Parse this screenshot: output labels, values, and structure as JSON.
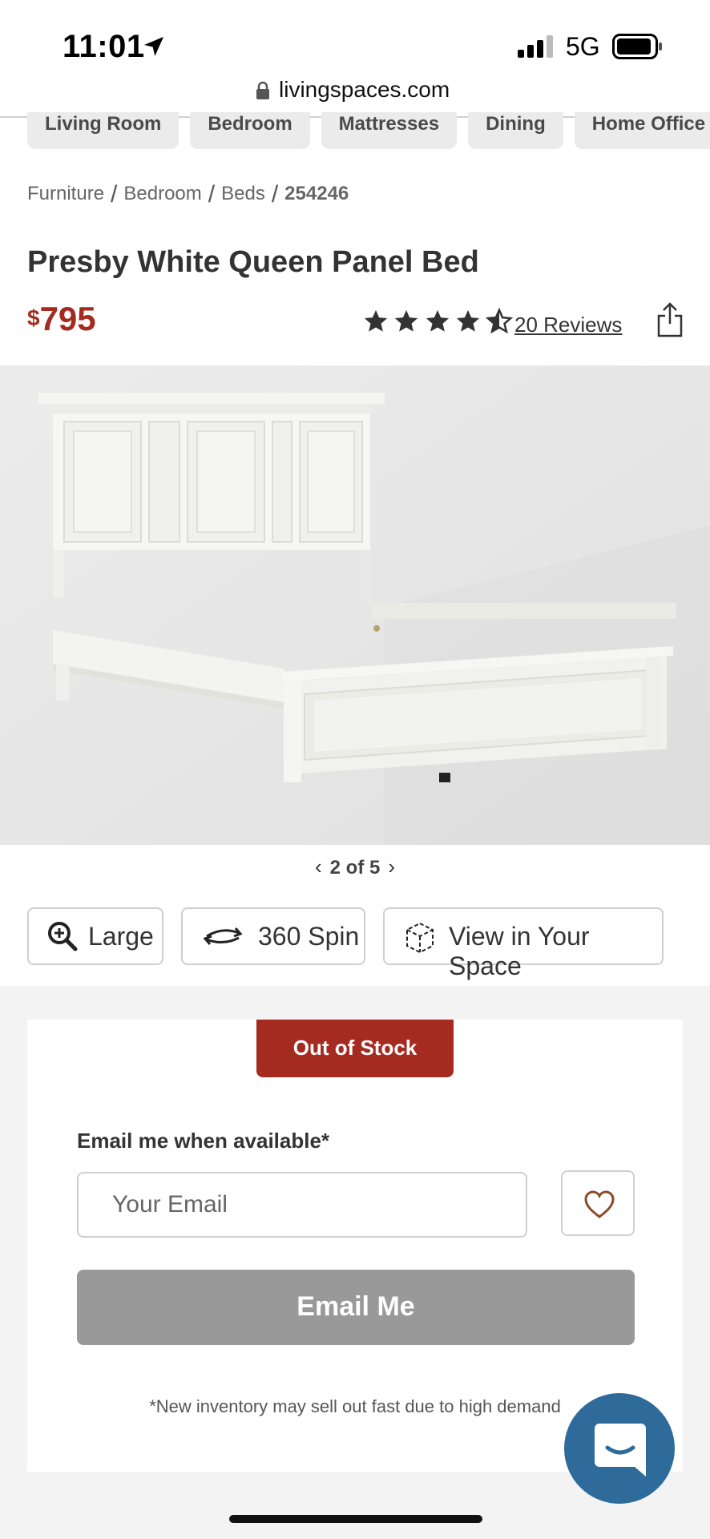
{
  "status_bar": {
    "time": "11:01",
    "network": "5G",
    "url": "livingspaces.com"
  },
  "categories": [
    "Living Room",
    "Bedroom",
    "Mattresses",
    "Dining",
    "Home Office"
  ],
  "breadcrumb": {
    "items": [
      "Furniture",
      "Bedroom",
      "Beds"
    ],
    "current": "254246"
  },
  "product": {
    "title": "Presby White Queen Panel Bed",
    "price_symbol": "$",
    "price": "795",
    "rating": 4.5,
    "reviews_label": "20 Reviews",
    "pager": "2 of 5"
  },
  "tools": {
    "large_label": "Large",
    "spin_label": "360 Spin",
    "space_label": "View in Your Space"
  },
  "availability": {
    "badge": "Out of Stock",
    "email_label": "Email me when available*",
    "email_placeholder": "Your Email",
    "email_button": "Email Me",
    "disclaimer": "*New inventory may sell out fast due to high demand"
  },
  "colors": {
    "brand_red": "#a52a1f",
    "disabled_gray": "#999999",
    "chat_blue": "#2f6b9a"
  }
}
